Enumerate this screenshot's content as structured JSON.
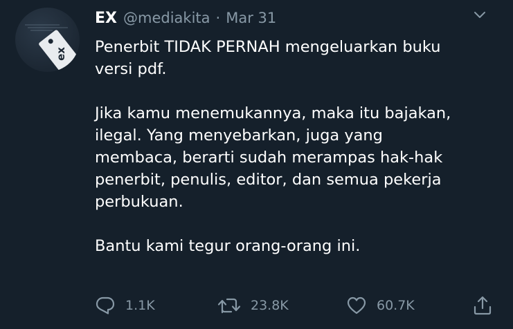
{
  "author": {
    "display_name": "EX",
    "handle": "@mediakita",
    "separator": "·",
    "date": "Mar 31",
    "avatar_logo_text": "ex"
  },
  "tweet": {
    "paragraph_1": "Penerbit TIDAK PERNAH mengeluarkan buku\nversi pdf.",
    "paragraph_2": "Jika kamu menemukannya, maka itu bajakan,\nilegal. Yang menyebarkan, juga yang\nmembaca, berarti sudah merampas hak-hak\npenerbit, penulis, editor, dan semua pekerja\nperbukuan.",
    "paragraph_3": "Bantu kami tegur orang-orang ini."
  },
  "actions": {
    "reply_count": "1.1K",
    "retweet_count": "23.8K",
    "like_count": "60.7K"
  },
  "icons": {
    "reply": "reply-icon",
    "retweet": "retweet-icon",
    "like": "heart-icon",
    "share": "share-icon",
    "menu": "chevron-down-icon"
  },
  "colors": {
    "background": "#15202b",
    "text": "#ffffff",
    "secondary": "#8899a6"
  }
}
